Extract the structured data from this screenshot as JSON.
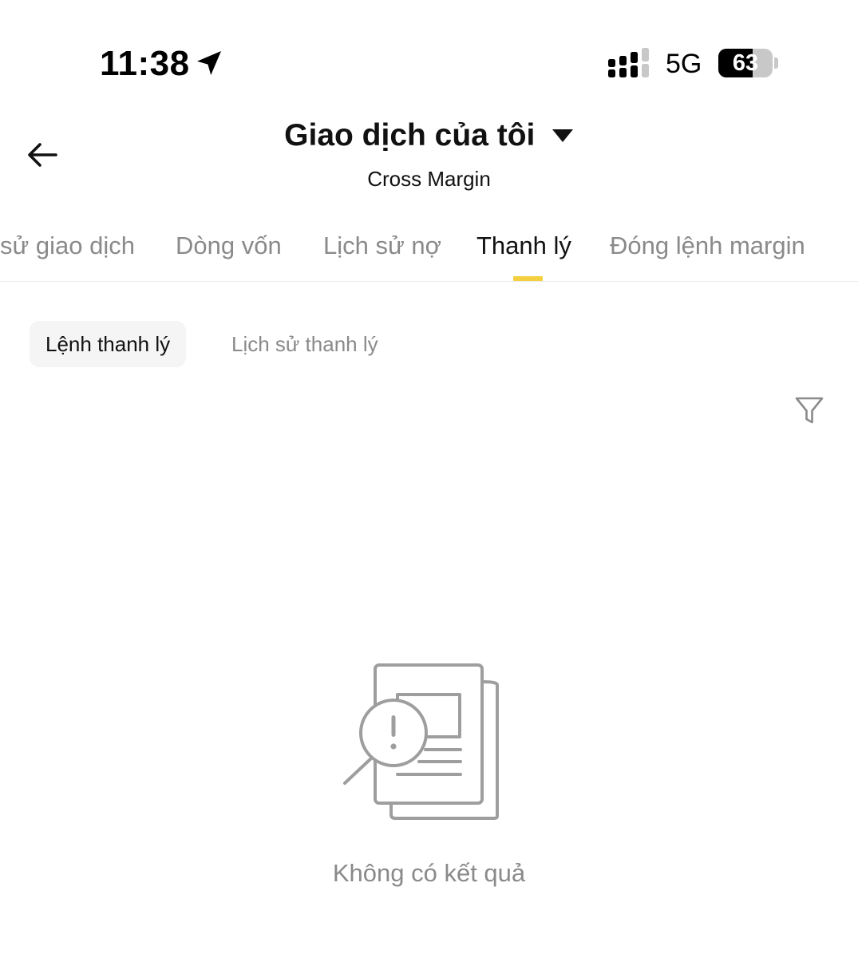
{
  "status_bar": {
    "time": "11:38",
    "network": "5G",
    "battery_percent": 63,
    "battery_label": "63",
    "icons": {
      "location": "location-arrow-icon",
      "signal": "cellular-signal-icon"
    }
  },
  "header": {
    "back_icon": "arrow-left-icon",
    "title": "Giao dịch của tôi",
    "title_dropdown_icon": "caret-down-icon",
    "subtitle": "Cross Margin"
  },
  "main_tabs": {
    "items": [
      {
        "label": "sử giao dịch",
        "active": false
      },
      {
        "label": "Dòng vốn",
        "active": false
      },
      {
        "label": "Lịch sử nợ",
        "active": false
      },
      {
        "label": "Thanh lý",
        "active": true
      },
      {
        "label": "Đóng lệnh margin",
        "active": false
      }
    ],
    "indicator_color": "#F4D03F"
  },
  "sub_tabs": {
    "items": [
      {
        "label": "Lệnh thanh lý",
        "active": true
      },
      {
        "label": "Lịch sử thanh lý",
        "active": false
      }
    ]
  },
  "toolbar": {
    "filter_icon": "filter-funnel-icon"
  },
  "empty_state": {
    "icon": "no-results-document-search-icon",
    "message": "Không có kết quả"
  },
  "colors": {
    "text_primary": "#111111",
    "text_secondary": "#8A8A8A",
    "accent": "#F4D03F",
    "chip_background": "#F5F5F5",
    "divider": "#ECECEC",
    "illustration_stroke": "#9E9E9E"
  }
}
